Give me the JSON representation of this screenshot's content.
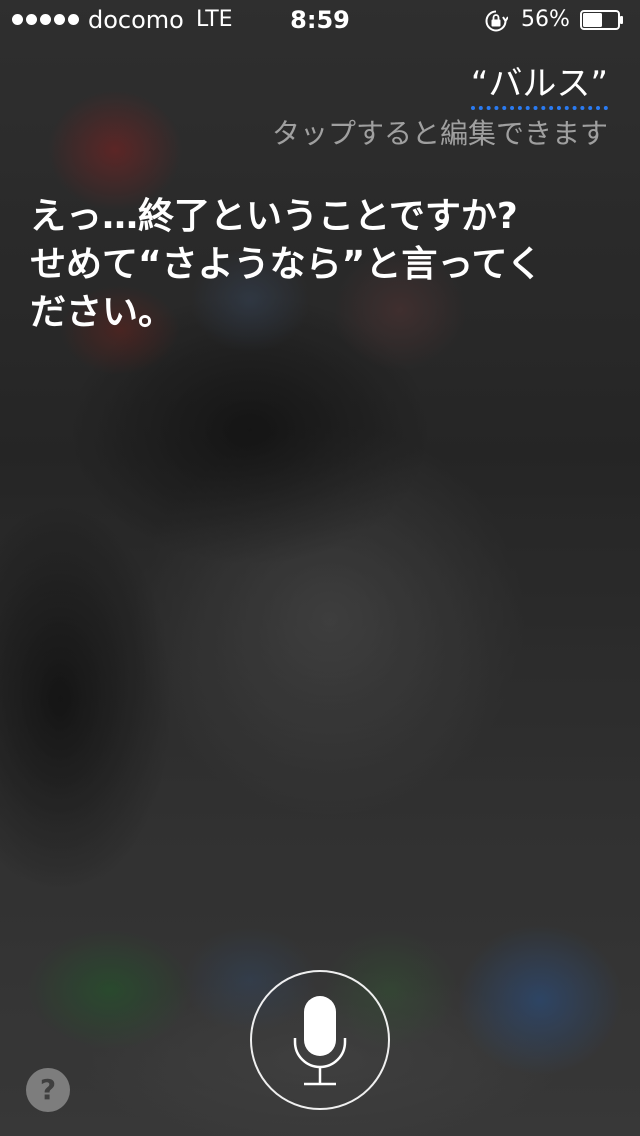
{
  "status_bar": {
    "carrier": "docomo",
    "network": "LTE",
    "time": "8:59",
    "battery_percent": "56%",
    "battery_level": 0.56,
    "signal_bars": 5,
    "lock_rotation_icon": "orientation-lock-icon"
  },
  "siri": {
    "query": "“バルス”",
    "tap_hint": "タップすると編集できます",
    "response": "えっ…終了ということですか?\nせめて“さようなら”と言ってく\nださい。"
  },
  "controls": {
    "mic_icon": "microphone-icon",
    "help_label": "?"
  },
  "colors": {
    "accent_underline": "#2a7bf2",
    "text": "#ffffff",
    "hint_text": "rgba(230,230,230,0.62)"
  }
}
